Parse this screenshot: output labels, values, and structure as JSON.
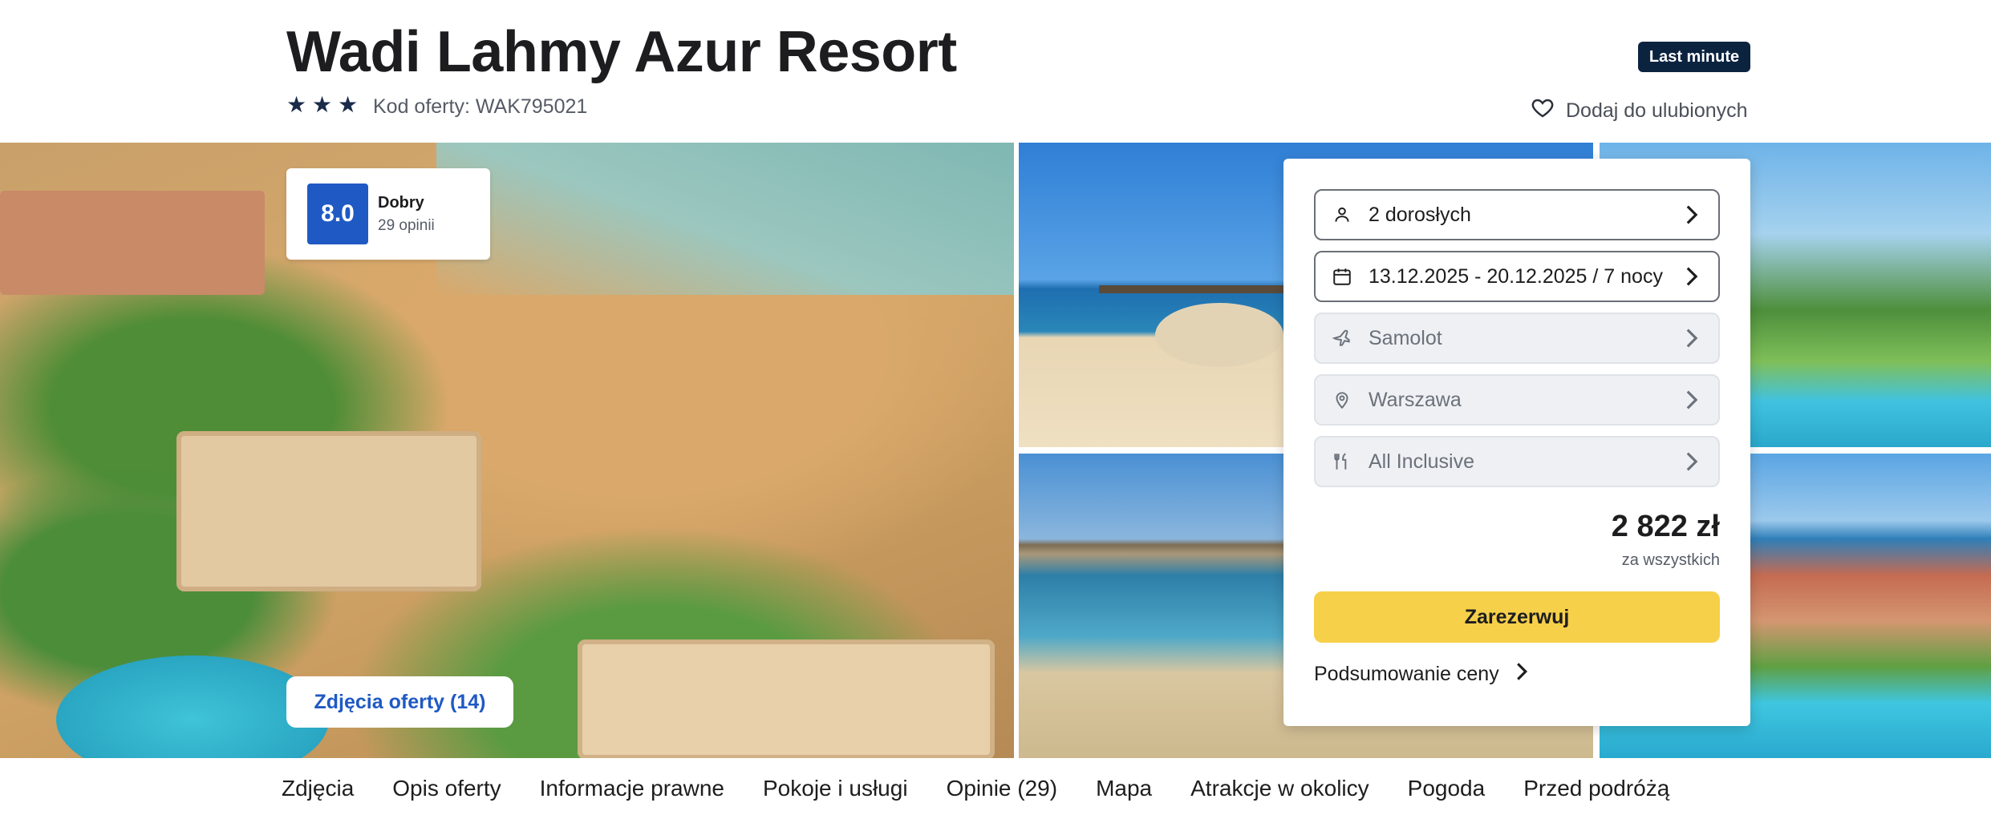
{
  "header": {
    "title": "Wadi Lahmy Azur Resort",
    "stars": [
      "★",
      "★",
      "★"
    ],
    "offer_code": "Kod oferty: WAK795021",
    "badge": "Last minute",
    "favorite_label": "Dodaj do ulubionych"
  },
  "gallery": {
    "rating": {
      "score": "8.0",
      "label": "Dobry",
      "count": "29 opinii"
    },
    "photos_button": "Zdjęcia oferty (14)"
  },
  "booking": {
    "fields": [
      {
        "icon": "person-icon",
        "label": "2 dorosłych",
        "state": "active"
      },
      {
        "icon": "calendar-icon",
        "label": "13.12.2025 - 20.12.2025 / 7 nocy",
        "state": "active"
      },
      {
        "icon": "plane-icon",
        "label": "Samolot",
        "state": "muted"
      },
      {
        "icon": "location-pin-icon",
        "label": "Warszawa",
        "state": "muted"
      },
      {
        "icon": "fork-knife-icon",
        "label": "All Inclusive",
        "state": "muted"
      }
    ],
    "price": "2 822 zł",
    "price_note": "za wszystkich",
    "book_label": "Zarezerwuj",
    "summary_label": "Podsumowanie ceny"
  },
  "nav": [
    "Zdjęcia",
    "Opis oferty",
    "Informacje prawne",
    "Pokoje i usługi",
    "Opinie (29)",
    "Mapa",
    "Atrakcje w okolicy",
    "Pogoda",
    "Przed podróżą"
  ],
  "colors": {
    "brand_blue": "#1f59c4",
    "badge_navy": "#0c2340",
    "book_yellow": "#f7d04a"
  }
}
